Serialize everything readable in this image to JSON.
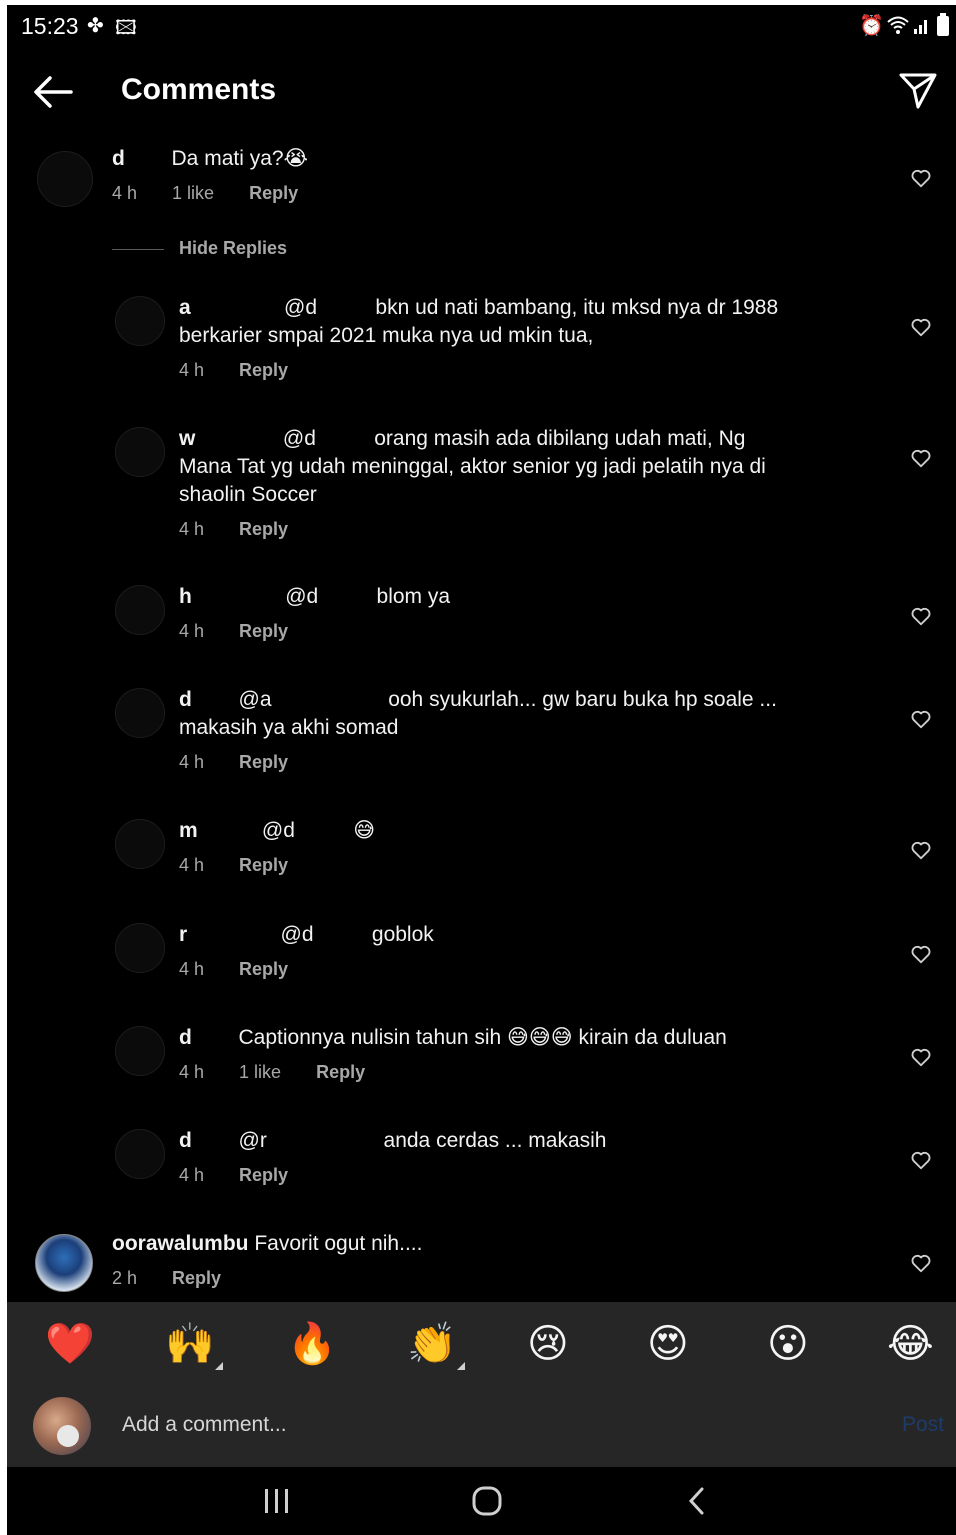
{
  "status_bar": {
    "time": "15:23",
    "icons": [
      "fan-icon",
      "image-icon",
      "alarm-icon",
      "wifi-icon",
      "signal-icon",
      "battery-icon"
    ]
  },
  "header": {
    "title": "Comments",
    "back_icon": "arrow-left-icon",
    "share_icon": "send-icon"
  },
  "comments": [
    {
      "user": "d",
      "text": "Da mati ya?😭",
      "time": "4 h",
      "likes": "1 like",
      "reply": "Reply",
      "hide_replies": "Hide Replies"
    },
    {
      "user": "a",
      "text": "@d          bkn ud nati bambang, itu mksd nya dr 1988\nberkarier smpai 2021 muka nya ud mkin tua,",
      "time": "4 h",
      "reply": "Reply"
    },
    {
      "user": "w",
      "text": "@d          orang masih ada dibilang udah mati, Ng\nMana Tat yg udah meninggal, aktor senior yg jadi pelatih nya di\nshaolin Soccer",
      "time": "4 h",
      "reply": "Reply"
    },
    {
      "user": "h",
      "text": "@d          blom ya",
      "time": "4 h",
      "reply": "Reply"
    },
    {
      "user": "d",
      "text": "@a                    ooh syukurlah... gw baru buka hp soale ...\nmakasih ya akhi somad",
      "time": "4 h",
      "reply": "Reply"
    },
    {
      "user": "m",
      "text": "@d          😅",
      "time": "4 h",
      "reply": "Reply"
    },
    {
      "user": "r",
      "text": "@d          goblok",
      "time": "4 h",
      "reply": "Reply"
    },
    {
      "user": "d",
      "text": "Captionnya nulisin tahun sih 😅😅😅 kirain da duluan",
      "time": "4 h",
      "likes": "1 like",
      "reply": "Reply"
    },
    {
      "user": "d",
      "text": "@r                    anda cerdas ... makasih",
      "time": "4 h",
      "reply": "Reply"
    },
    {
      "user": "oorawalumbu",
      "text": "Favorit ogut nih....",
      "time": "2 h",
      "reply": "Reply"
    }
  ],
  "emoji_bar": [
    "❤️",
    "🙌",
    "🔥",
    "👏",
    "😢",
    "😍",
    "😮",
    "😂"
  ],
  "composer": {
    "placeholder": "Add a comment...",
    "post": "Post"
  },
  "nav": [
    "recent-apps-icon",
    "home-icon",
    "back-icon"
  ]
}
